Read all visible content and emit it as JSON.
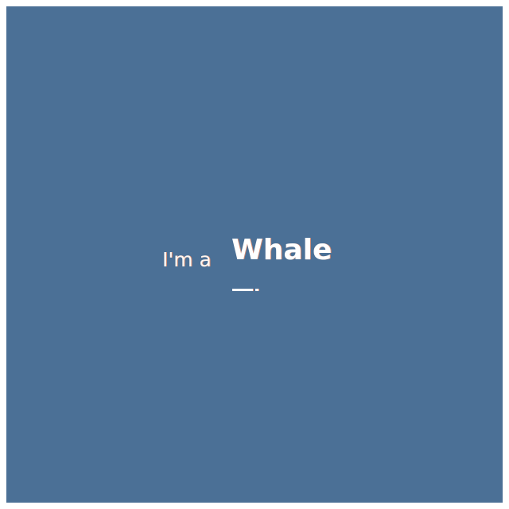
{
  "headline": {
    "prefix": "I'm a",
    "word": "Whale"
  },
  "colors": {
    "background": "#4b7096",
    "text": "#ffffff",
    "text_fringe": "#d08b74"
  }
}
